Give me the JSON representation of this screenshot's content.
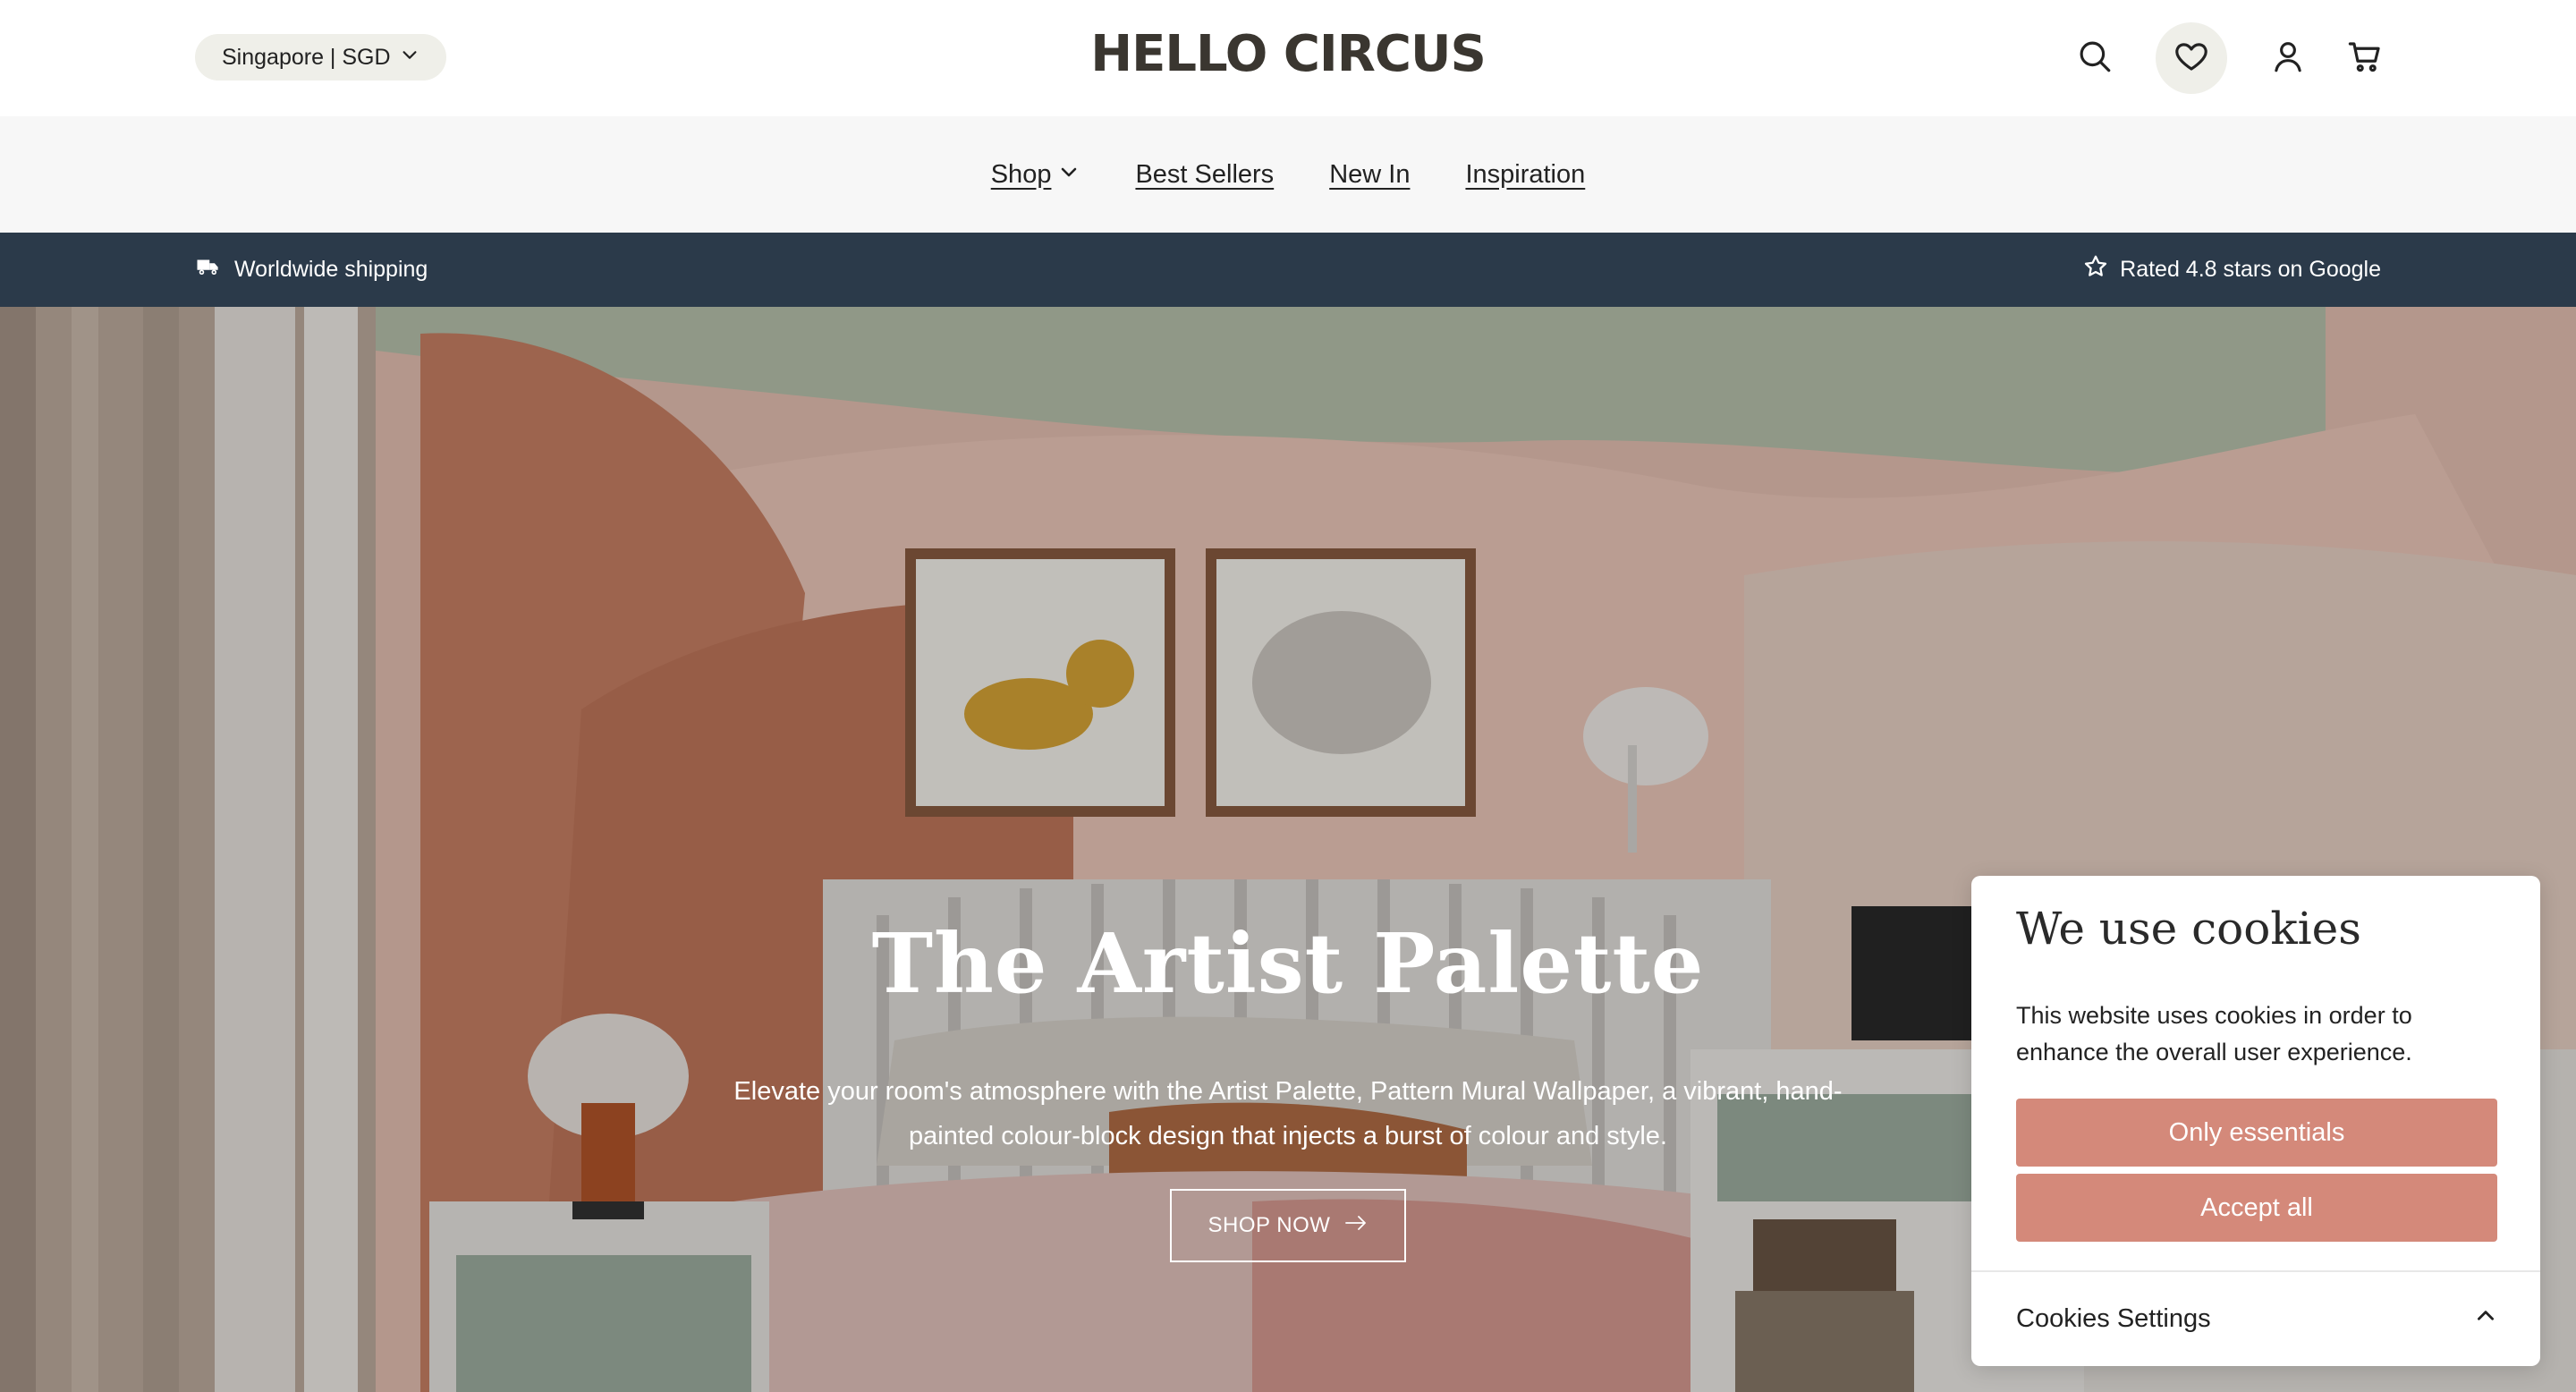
{
  "header": {
    "region_label": "Singapore | SGD",
    "logo_text": "HELLO CIRCUS",
    "icons": [
      "search-icon",
      "heart-icon",
      "user-icon",
      "cart-icon"
    ]
  },
  "nav": {
    "items": [
      {
        "label": "Shop",
        "has_dropdown": true
      },
      {
        "label": "Best Sellers"
      },
      {
        "label": "New In"
      },
      {
        "label": "Inspiration"
      }
    ]
  },
  "announcement": {
    "left_text": "Worldwide shipping",
    "right_text": "Rated 4.8 stars on Google"
  },
  "hero": {
    "title": "The Artist Palette",
    "subtitle": "Elevate your room's atmosphere with the Artist Palette, Pattern Mural Wallpaper, a vibrant, hand-painted colour-block design that injects a burst of colour and style.",
    "cta_label": "SHOP NOW"
  },
  "cookie_banner": {
    "title": "We use cookies",
    "text": "This website uses cookies in order to enhance the overall user experience.",
    "only_essentials_label": "Only essentials",
    "accept_all_label": "Accept all",
    "settings_label": "Cookies Settings"
  },
  "colors": {
    "announcement_bg": "#2b3a4a",
    "cookie_button": "#d4897a",
    "pill_bg": "#efefe9"
  }
}
